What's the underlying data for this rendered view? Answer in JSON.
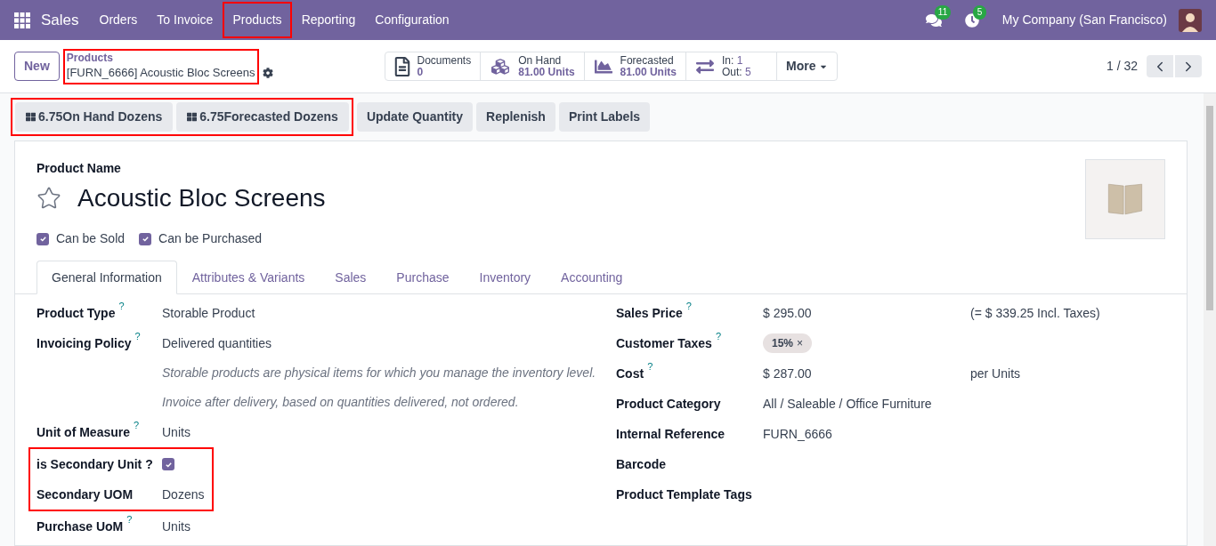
{
  "navbar": {
    "app": "Sales",
    "menu": [
      {
        "label": "Orders",
        "highlighted": false
      },
      {
        "label": "To Invoice",
        "highlighted": false
      },
      {
        "label": "Products",
        "highlighted": true
      },
      {
        "label": "Reporting",
        "highlighted": false
      },
      {
        "label": "Configuration",
        "highlighted": false
      }
    ],
    "messages_badge": "11",
    "activities_badge": "5",
    "company": "My Company (San Francisco)"
  },
  "control_panel": {
    "new_button": "New",
    "breadcrumb": {
      "parent": "Products",
      "current": "[FURN_6666] Acoustic Bloc Screens",
      "highlighted": true
    },
    "smart_buttons": [
      {
        "kind": "documents",
        "title": "Documents",
        "value": "0"
      },
      {
        "kind": "on_hand",
        "title": "On Hand",
        "value": "81.00 Units"
      },
      {
        "kind": "forecast",
        "title": "Forecasted",
        "value": "81.00 Units"
      },
      {
        "kind": "moves",
        "title": "In:",
        "value": "1",
        "title2": "Out:",
        "value2": "5"
      }
    ],
    "more": "More",
    "pager": "1 / 32"
  },
  "stat_buttons": {
    "highlighted": true,
    "items": [
      {
        "value": "6.75",
        "label": "On Hand Dozens"
      },
      {
        "value": "6.75",
        "label": "Forecasted Dozens"
      }
    ]
  },
  "action_buttons": [
    "Update Quantity",
    "Replenish",
    "Print Labels"
  ],
  "sheet": {
    "name_label": "Product Name",
    "name": "Acoustic Bloc Screens",
    "starred": false,
    "checkboxes": [
      {
        "label": "Can be Sold",
        "checked": true
      },
      {
        "label": "Can be Purchased",
        "checked": true
      }
    ],
    "tabs": [
      {
        "label": "General Information",
        "selected": true
      },
      {
        "label": "Attributes & Variants",
        "selected": false
      },
      {
        "label": "Sales",
        "selected": false
      },
      {
        "label": "Purchase",
        "selected": false
      },
      {
        "label": "Inventory",
        "selected": false
      },
      {
        "label": "Accounting",
        "selected": false
      }
    ],
    "left_fields": [
      {
        "kind": "field",
        "label": "Product Type",
        "help": "?",
        "value": "Storable Product"
      },
      {
        "kind": "field",
        "label": "Invoicing Policy",
        "help": "?",
        "value": "Delivered quantities"
      },
      {
        "kind": "note",
        "text": "Storable products are physical items for which you manage the inventory level."
      },
      {
        "kind": "note",
        "text": "Invoice after delivery, based on quantities delivered, not ordered."
      },
      {
        "kind": "field",
        "label": "Unit of Measure",
        "help": "?",
        "value": "Units"
      },
      {
        "kind": "group",
        "highlighted": true,
        "fields": [
          {
            "kind": "check",
            "label": "is Secondary Unit ?",
            "checked": true
          },
          {
            "kind": "field",
            "label": "Secondary UOM",
            "value": "Dozens"
          }
        ]
      },
      {
        "kind": "field",
        "label": "Purchase UoM",
        "help": "?",
        "value": "Units"
      }
    ],
    "right_fields": [
      {
        "kind": "field",
        "label": "Sales Price",
        "help": "?",
        "value": "$ 295.00",
        "extra": "(= $ 339.25 Incl. Taxes)"
      },
      {
        "kind": "tags",
        "label": "Customer Taxes",
        "help": "?",
        "tags": [
          {
            "label": "15%",
            "remove": "×"
          }
        ]
      },
      {
        "kind": "field",
        "label": "Cost",
        "help": "?",
        "value": "$ 287.00",
        "extra": "per Units"
      },
      {
        "kind": "field",
        "label": "Product Category",
        "value": "All / Saleable / Office Furniture"
      },
      {
        "kind": "field",
        "label": "Internal Reference",
        "value": "FURN_6666"
      },
      {
        "kind": "field",
        "label": "Barcode"
      },
      {
        "kind": "field",
        "label": "Product Template Tags"
      }
    ]
  }
}
